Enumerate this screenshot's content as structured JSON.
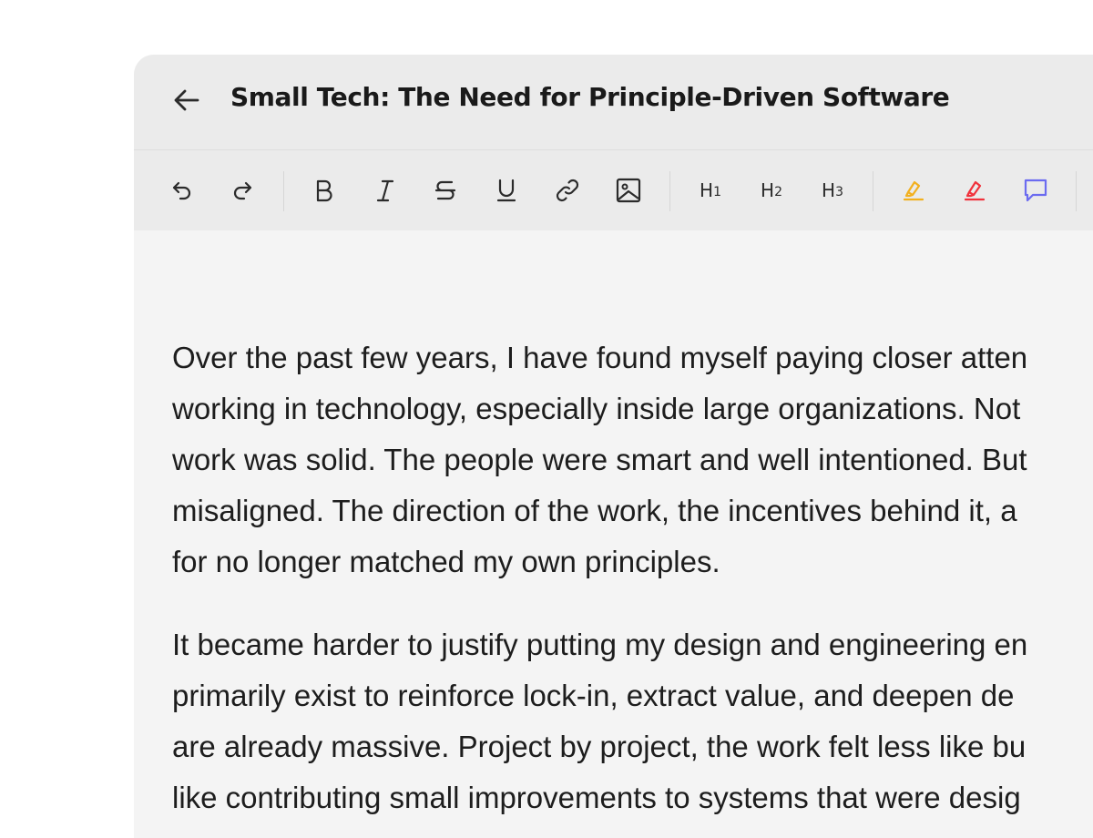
{
  "header": {
    "title": "Small Tech: The Need for Principle-Driven Software",
    "back_icon": "arrow-left-icon"
  },
  "toolbar": {
    "groups": [
      [
        "undo-icon",
        "redo-icon"
      ],
      [
        "bold-icon",
        "italic-icon",
        "strikethrough-icon",
        "underline-icon",
        "link-icon",
        "image-icon"
      ],
      [
        "heading-1",
        "heading-2",
        "heading-3"
      ],
      [
        "highlight-yellow-icon",
        "highlight-red-icon",
        "comment-icon"
      ]
    ],
    "h1_letter": "H",
    "h1_sub": "1",
    "h2_letter": "H",
    "h2_sub": "2",
    "h3_letter": "H",
    "h3_sub": "3",
    "colors": {
      "highlight_yellow": "#f2b01e",
      "highlight_red": "#f0323c",
      "comment": "#6b6bf0"
    }
  },
  "body": {
    "paragraph1": {
      "line1": "Over the past few years, I have found myself paying closer atten",
      "line2": "working in technology, especially inside large organizations. Not",
      "line3": "work was solid. The people were smart and well intentioned. But",
      "line4": "misaligned. The direction of the work, the incentives behind it, a",
      "line5": "for no longer matched my own principles."
    },
    "paragraph2": {
      "line1": "It became harder to justify putting my design and engineering en",
      "line2": "primarily exist to reinforce lock-in, extract value, and deepen de",
      "line3": "are already massive. Project by project, the work felt less like bu",
      "line4": "like contributing small improvements to systems that were desig"
    }
  }
}
